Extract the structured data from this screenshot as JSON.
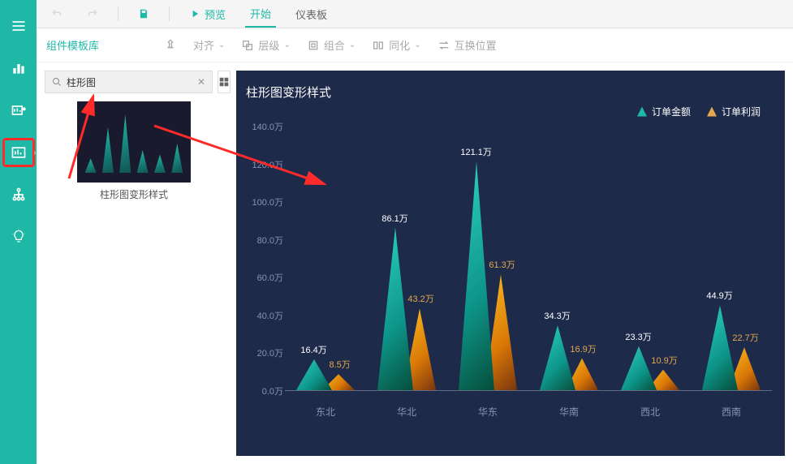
{
  "topbar1": {
    "preview": "预览",
    "start": "开始",
    "dashboard": "仪表板"
  },
  "topbar2": {
    "label": "组件模板库",
    "align": "对齐",
    "layer": "层级",
    "group": "组合",
    "equalize": "同化",
    "swap": "互换位置"
  },
  "search": {
    "value": "柱形图"
  },
  "template": {
    "title": "柱形图变形样式"
  },
  "chart_data": {
    "type": "bar",
    "title": "柱形图变形样式",
    "categories": [
      "东北",
      "华北",
      "华东",
      "华南",
      "西北",
      "西南"
    ],
    "series": [
      {
        "name": "订单金额",
        "values": [
          16.4,
          86.1,
          121.1,
          34.3,
          23.3,
          44.9
        ],
        "color": "#1fb8a6"
      },
      {
        "name": "订单利润",
        "values": [
          8.5,
          43.2,
          61.3,
          16.9,
          10.9,
          22.7
        ],
        "color": "#e5a84f"
      }
    ],
    "ylabel_suffix": "万",
    "ylim": [
      0,
      140
    ],
    "y_ticks": [
      0.0,
      20.0,
      40.0,
      60.0,
      80.0,
      100.0,
      120.0,
      140.0
    ],
    "y_tick_labels": [
      "0.0万",
      "20.0万",
      "40.0万",
      "60.0万",
      "80.0万",
      "100.0万",
      "120.0万",
      "140.0万"
    ]
  }
}
